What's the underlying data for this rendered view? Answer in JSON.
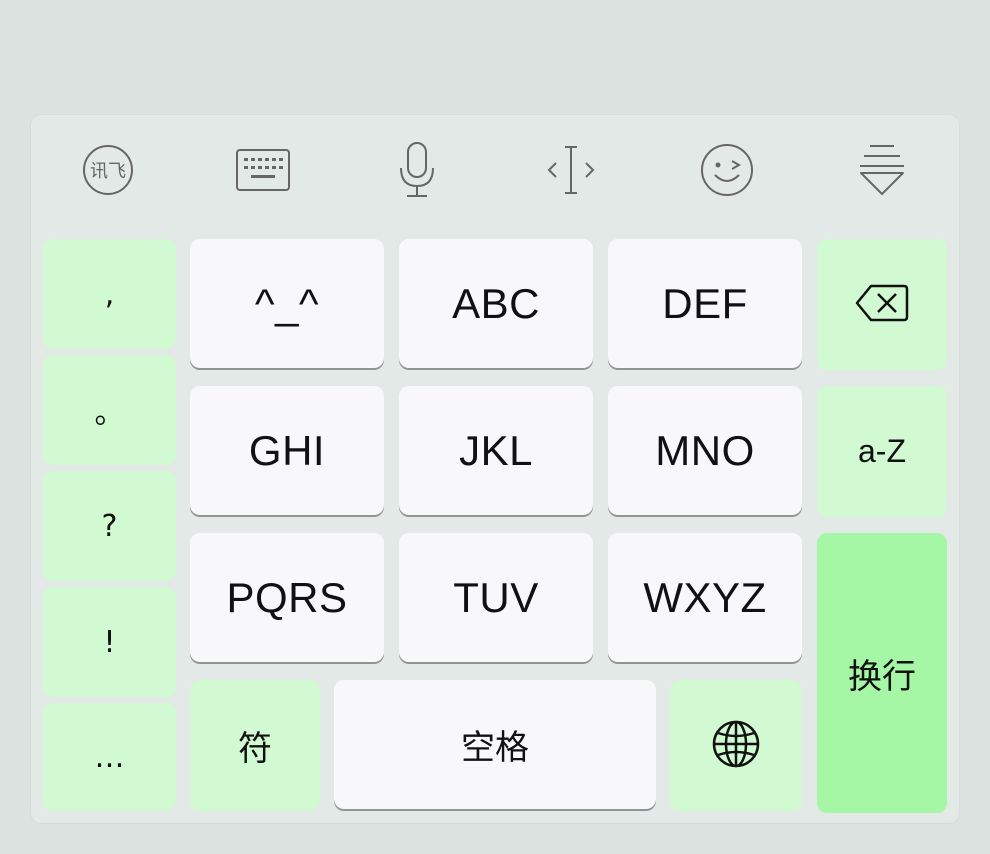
{
  "toolbar": {
    "items": [
      {
        "icon": "iflytek-logo-icon",
        "label": "讯飞"
      },
      {
        "icon": "keyboard-icon"
      },
      {
        "icon": "microphone-icon"
      },
      {
        "icon": "cursor-move-icon"
      },
      {
        "icon": "emoji-wink-icon"
      },
      {
        "icon": "hide-keyboard-icon"
      }
    ]
  },
  "punctuation": [
    ",",
    "。",
    "?",
    "!",
    "…"
  ],
  "keys": {
    "k1": "^_^",
    "k2": "ABC",
    "k3": "DEF",
    "k4": "GHI",
    "k5": "JKL",
    "k6": "MNO",
    "k7": "PQRS",
    "k8": "TUV",
    "k9": "WXYZ",
    "symbols": "符",
    "space": "空格",
    "case_toggle": "a-Z",
    "enter": "换行"
  },
  "icons": {
    "backspace": "backspace-icon",
    "globe": "globe-icon"
  },
  "colors": {
    "keyboard_bg": "#e3e9e6",
    "letter_key": "#f8f8fb",
    "function_key": "#d2fad2",
    "enter_key": "#a5f7a5"
  }
}
